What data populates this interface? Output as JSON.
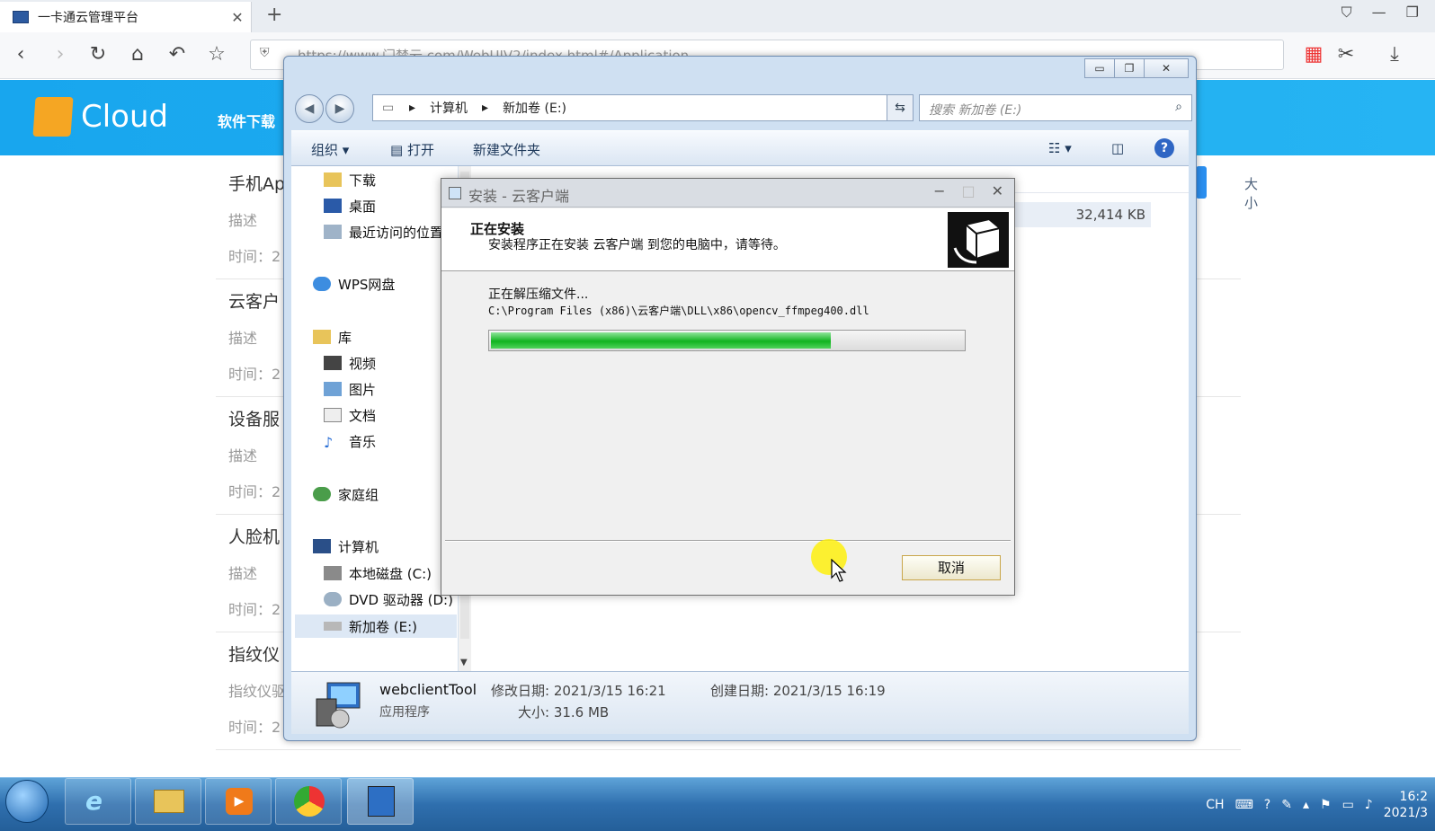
{
  "browser": {
    "tab_title": "一卡通云管理平台",
    "address": "https://www.门禁云.com/WebUIV2/index.html#/Application"
  },
  "site": {
    "logo_text": "Cloud",
    "nav_item": "软件下载",
    "items": [
      {
        "title": "手机Ap",
        "desc": "描述",
        "time": "时间：2"
      },
      {
        "title": "云客户",
        "desc": "描述",
        "time": "时间：2"
      },
      {
        "title": "设备服",
        "desc": "描述",
        "time": "时间：2"
      },
      {
        "title": "人脸机",
        "desc": "描述",
        "time": "时间：2"
      },
      {
        "title": "指纹仪",
        "desc": "指纹仪驱",
        "time": "时间：2"
      }
    ]
  },
  "explorer": {
    "breadcrumb": [
      "计算机",
      "新加卷 (E:)"
    ],
    "search_placeholder": "搜索 新加卷 (E:)",
    "toolbar": {
      "organize": "组织",
      "open": "打开",
      "new_folder": "新建文件夹"
    },
    "nav": {
      "downloads": "下载",
      "desktop": "桌面",
      "recent": "最近访问的位置",
      "wps": "WPS网盘",
      "library": "库",
      "videos": "视频",
      "pictures": "图片",
      "documents": "文档",
      "music": "音乐",
      "homegroup": "家庭组",
      "computer": "计算机",
      "local_disk": "本地磁盘 (C:)",
      "dvd": "DVD 驱动器 (D:)",
      "new_volume": "新加卷 (E:)"
    },
    "columns": {
      "size": "大小"
    },
    "file_size": "32,414 KB",
    "details": {
      "name": "webclientTool",
      "type": "应用程序",
      "modified": "修改日期: 2021/3/15 16:21",
      "created": "创建日期: 2021/3/15 16:19",
      "size": "大小: 31.6 MB"
    }
  },
  "installer": {
    "title": "安装 - 云客户端",
    "heading": "正在安装",
    "subheading": "安装程序正在安装 云客户端 到您的电脑中，请等待。",
    "status": "正在解压缩文件...",
    "path": "C:\\Program Files (x86)\\云客户端\\DLL\\x86\\opencv_ffmpeg400.dll",
    "progress": 0.72,
    "cancel": "取消"
  },
  "taskbar": {
    "lang": "CH",
    "time": "16:2",
    "date": "2021/3"
  }
}
